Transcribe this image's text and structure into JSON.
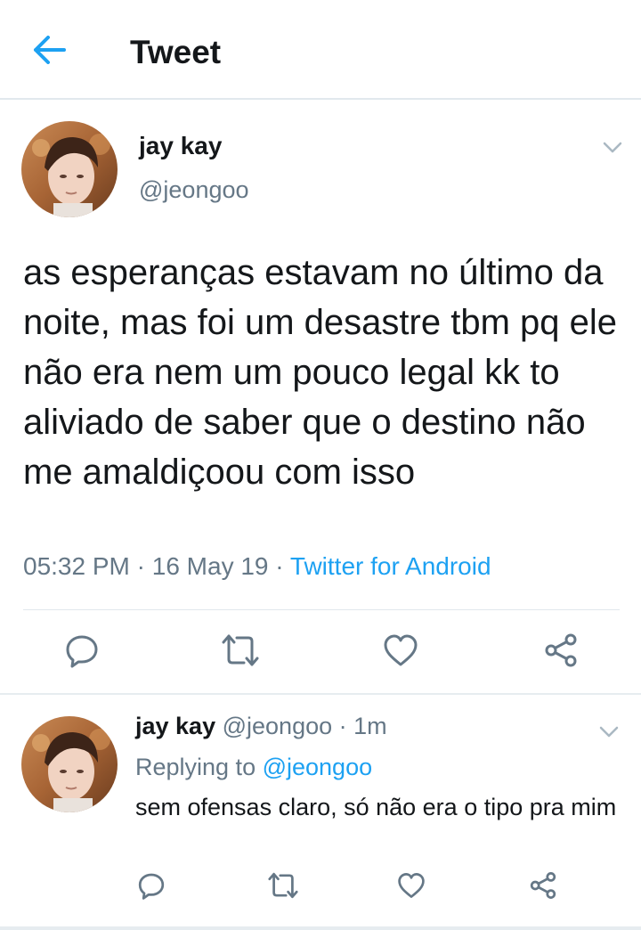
{
  "header": {
    "title": "Tweet",
    "back_icon": "arrow-left-icon",
    "accent": "#1da1f2"
  },
  "tweet": {
    "display_name": "jay kay",
    "handle": "@jeongoo",
    "text": "as esperanças estavam no último da noite, mas foi um desastre tbm pq ele não era nem um pouco legal kk to aliviado de saber que o destino não me amaldiçoou com isso",
    "time": "05:32 PM",
    "sep1": " · ",
    "date": "16 May 19",
    "sep2": " · ",
    "source": "Twitter for Android",
    "actions": [
      "reply-icon",
      "retweet-icon",
      "like-icon",
      "share-icon"
    ]
  },
  "reply": {
    "display_name": "jay kay",
    "handle": "@jeongoo",
    "sep": " · ",
    "age": "1m",
    "replying_prefix": "Replying to ",
    "replying_to": "@jeongoo",
    "text": "sem ofensas claro, só não era o tipo pra mim",
    "actions": [
      "reply-icon",
      "retweet-icon",
      "like-icon",
      "share-icon"
    ]
  },
  "colors": {
    "text": "#14171a",
    "muted": "#657786",
    "link": "#1da1f2",
    "border": "#e1e8ed"
  }
}
